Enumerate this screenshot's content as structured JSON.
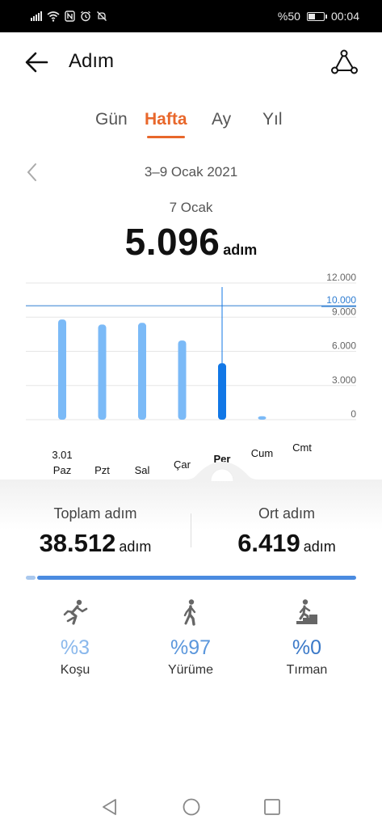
{
  "status_bar": {
    "battery": "%50",
    "battery_level": 0.5,
    "time": "00:04"
  },
  "header": {
    "title": "Adım",
    "back_icon": "arrow-left-icon",
    "share_icon": "nodes-share-icon"
  },
  "tabs": [
    {
      "label": "Gün",
      "active": false
    },
    {
      "label": "Hafta",
      "active": true
    },
    {
      "label": "Ay",
      "active": false
    },
    {
      "label": "Yıl",
      "active": false
    }
  ],
  "date_nav": {
    "range": "3–9 Ocak 2021"
  },
  "selected": {
    "day": "7 Ocak",
    "steps": "5.096",
    "unit": "adım"
  },
  "chart_data": {
    "type": "bar",
    "categories": [
      "Paz",
      "Pzt",
      "Sal",
      "Çar",
      "Per",
      "Cum",
      "Cmt"
    ],
    "first_date_label": "3.01",
    "values": [
      8800,
      8350,
      8500,
      6950,
      4950,
      300,
      0
    ],
    "selected_index": 4,
    "goal": 10000,
    "goal_label": "10.000",
    "ylim": [
      0,
      12000
    ],
    "yticks": [
      "12.000",
      "9.000",
      "6.000",
      "3.000",
      "0"
    ],
    "ytick_values": [
      12000,
      9000,
      6000,
      3000,
      0
    ],
    "colors": {
      "bar": "#7bbaf7",
      "selected": "#1177e6",
      "goal": "#2f7dd1"
    }
  },
  "summary": {
    "total": {
      "label": "Toplam adım",
      "value": "38.512",
      "unit": "adım"
    },
    "average": {
      "label": "Ort adım",
      "value": "6.419",
      "unit": "adım"
    }
  },
  "breakdown": [
    {
      "name": "Koşu",
      "pct": "%3",
      "fraction": 0.03,
      "icon": "running-person-icon",
      "color": "#8ab8ec"
    },
    {
      "name": "Yürüme",
      "pct": "%97",
      "fraction": 0.97,
      "icon": "walking-person-icon",
      "color": "#5b97dc"
    },
    {
      "name": "Tırman",
      "pct": "%0",
      "fraction": 0.0,
      "icon": "climbing-stairs-icon",
      "color": "#3b79c8"
    }
  ],
  "nav": {
    "back": "triangle-back-icon",
    "home": "circle-home-icon",
    "recent": "square-recent-icon"
  }
}
